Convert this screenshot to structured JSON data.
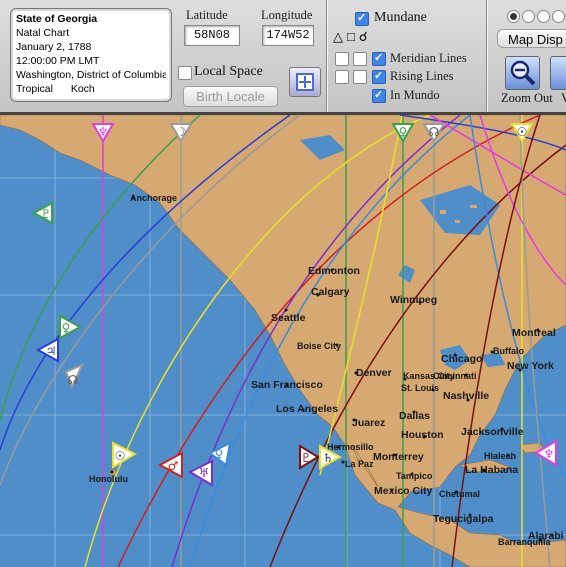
{
  "chart_info": {
    "name": "State of Georgia",
    "type": "Natal Chart",
    "date": "January 2, 1788",
    "time": "12:00:00 PM LMT",
    "place": "Washington,  District of Columbia",
    "zodiac": "Tropical",
    "house_system": "Koch"
  },
  "location": {
    "latitude_label": "Latitude",
    "latitude_value": "58N08",
    "longitude_label": "Longitude",
    "longitude_value": "174W52",
    "local_space_label": "Local Space",
    "local_space_checked": false,
    "birth_locale_label": "Birth Locale"
  },
  "options": {
    "mundane_label": "Mundane",
    "mundane_checked": true,
    "meridian_label": "Meridian Lines",
    "meridian_checked": true,
    "rising_label": "Rising Lines",
    "rising_checked": true,
    "in_mundo_label": "In Mundo",
    "in_mundo_checked": true,
    "aspect_glyphs": [
      "△",
      "□",
      "☌"
    ]
  },
  "view": {
    "map_display_label": "Map Disp",
    "zoom_out_label": "Zoom Out",
    "selected_radio": 0
  },
  "map": {
    "cities": [
      {
        "name": "Anchorage",
        "dot": true
      },
      {
        "name": "Edmonton",
        "dot": true
      },
      {
        "name": "Calgary",
        "dot": true
      },
      {
        "name": "Winnipeg",
        "dot": true
      },
      {
        "name": "Montreal",
        "dot": true
      },
      {
        "name": "Seattle",
        "dot": true
      },
      {
        "name": "Boise City",
        "dot": true
      },
      {
        "name": "Chicago",
        "dot": true
      },
      {
        "name": "Buffalo",
        "dot": true
      },
      {
        "name": "Denver",
        "dot": true
      },
      {
        "name": "Kansas City",
        "dot": true
      },
      {
        "name": "Cincinnati",
        "dot": true
      },
      {
        "name": "St. Louis",
        "dot": true
      },
      {
        "name": "New York",
        "dot": true
      },
      {
        "name": "San Francisco",
        "dot": true
      },
      {
        "name": "Nashville",
        "dot": true
      },
      {
        "name": "Los Angeles",
        "dot": true
      },
      {
        "name": "Dallas",
        "dot": true
      },
      {
        "name": "Juarez",
        "dot": true
      },
      {
        "name": "Houston",
        "dot": true
      },
      {
        "name": "Jacksonville",
        "dot": true
      },
      {
        "name": "Hermosillo",
        "dot": true
      },
      {
        "name": "Monterrey",
        "dot": true
      },
      {
        "name": "La Paz",
        "dot": true
      },
      {
        "name": "Tampico",
        "dot": true
      },
      {
        "name": "Mexico City",
        "dot": true
      },
      {
        "name": "Hialeah",
        "dot": true
      },
      {
        "name": "La Habana",
        "dot": true
      },
      {
        "name": "Chetumal",
        "dot": true
      },
      {
        "name": "Tegucigalpa",
        "dot": true
      },
      {
        "name": "Barranquilla",
        "dot": true
      },
      {
        "name": "Alarabi",
        "dot": true
      },
      {
        "name": "Honolulu",
        "dot": true
      }
    ],
    "planet_markers": [
      {
        "glyph": "♆",
        "color": "#e23ce0",
        "planet": "Neptune"
      },
      {
        "glyph": "☽",
        "color": "#9a9a9a",
        "planet": "Moon"
      },
      {
        "glyph": "♀",
        "color": "#3aa04a",
        "planet": "Venus"
      },
      {
        "glyph": "☊",
        "color": "#9a9a9a",
        "planet": "Node"
      },
      {
        "glyph": "☉",
        "color": "#e8e02a",
        "planet": "Sun"
      },
      {
        "glyph": "♇",
        "color": "#3aa04a",
        "planet": "Pluto"
      },
      {
        "glyph": "♀",
        "color": "#3aa04a",
        "planet": "Venus"
      },
      {
        "glyph": "♃",
        "color": "#2a3ed8",
        "planet": "Jupiter"
      },
      {
        "glyph": "☊",
        "color": "#9a9a9a",
        "planet": "Node"
      },
      {
        "glyph": "☉",
        "color": "#e8e02a",
        "planet": "Sun"
      },
      {
        "glyph": "♂",
        "color": "#d02020",
        "planet": "Mars"
      },
      {
        "glyph": "♅",
        "color": "#7a30d0",
        "planet": "Uranus"
      },
      {
        "glyph": "♀",
        "color": "#3a8ae0",
        "planet": "Venus"
      },
      {
        "glyph": "♇",
        "color": "#7a1010",
        "planet": "Pluto"
      },
      {
        "glyph": "♄",
        "color": "#e8e02a",
        "planet": "Saturn"
      },
      {
        "glyph": "♆",
        "color": "#e23ce0",
        "planet": "Neptune"
      }
    ]
  },
  "colors": {
    "ocean": "#4f8ec9",
    "land": "#d6a973",
    "grid": "#8fb8de"
  }
}
